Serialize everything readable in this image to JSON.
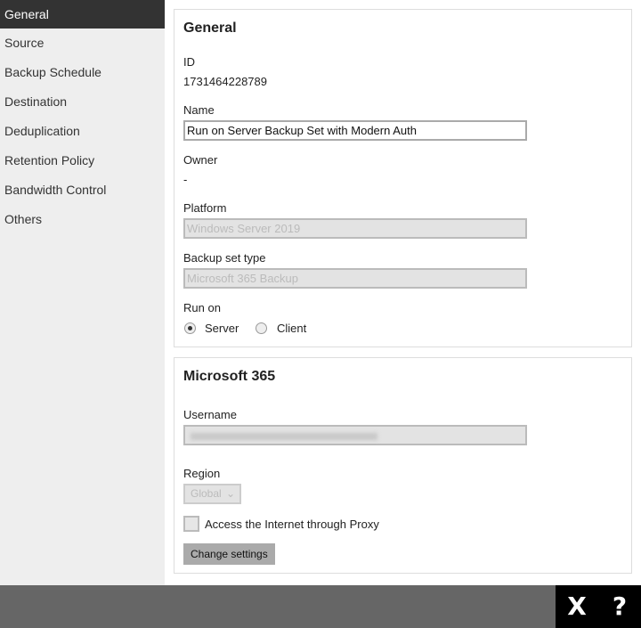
{
  "sidebar": {
    "items": [
      {
        "label": "General"
      },
      {
        "label": "Source"
      },
      {
        "label": "Backup Schedule"
      },
      {
        "label": "Destination"
      },
      {
        "label": "Deduplication"
      },
      {
        "label": "Retention Policy"
      },
      {
        "label": "Bandwidth Control"
      },
      {
        "label": "Others"
      }
    ]
  },
  "general": {
    "title": "General",
    "id_label": "ID",
    "id_value": "1731464228789",
    "name_label": "Name",
    "name_value": "Run on Server Backup Set with Modern Auth",
    "owner_label": "Owner",
    "owner_value": "-",
    "platform_label": "Platform",
    "platform_value": "Windows Server 2019",
    "type_label": "Backup set type",
    "type_value": "Microsoft 365 Backup",
    "runon_label": "Run on",
    "runon_server": "Server",
    "runon_client": "Client",
    "runon_selected": "Server"
  },
  "m365": {
    "title": "Microsoft 365",
    "username_label": "Username",
    "region_label": "Region",
    "region_value": "Global",
    "proxy_label": "Access the Internet through Proxy",
    "proxy_checked": false,
    "change_settings": "Change settings"
  },
  "footer": {
    "close": "X",
    "help": "?"
  }
}
